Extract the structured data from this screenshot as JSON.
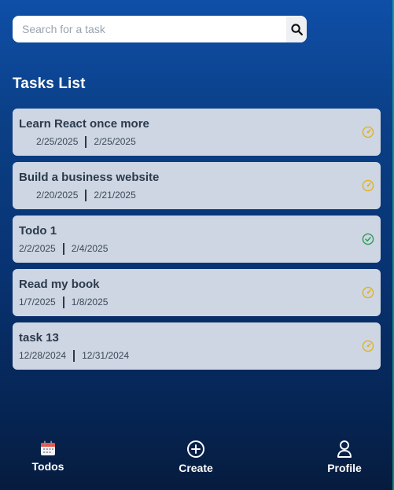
{
  "search": {
    "placeholder": "Search for a task"
  },
  "list": {
    "title": "Tasks List"
  },
  "tasks": [
    {
      "title": "Learn React once more",
      "start": "2/25/2025",
      "end": "2/25/2025",
      "status": "in-progress"
    },
    {
      "title": "Build a business website",
      "start": "2/20/2025",
      "end": "2/21/2025",
      "status": "in-progress"
    },
    {
      "title": "Todo 1",
      "start": "2/2/2025",
      "end": "2/4/2025",
      "status": "done"
    },
    {
      "title": "Read my book",
      "start": "1/7/2025",
      "end": "1/8/2025",
      "status": "in-progress"
    },
    {
      "title": "task 13",
      "start": "12/28/2024",
      "end": "12/31/2024",
      "status": "in-progress"
    }
  ],
  "nav": {
    "todos": "Todos",
    "create": "Create",
    "profile": "Profile"
  },
  "colors": {
    "in_progress": "#e2b21f",
    "done": "#2e9b53",
    "card": "#cdd6e2"
  },
  "icons": {
    "search": "search-icon",
    "in_progress": "speedometer-icon",
    "done": "check-circle-icon",
    "todos": "calendar-icon",
    "create": "plus-circle-icon",
    "profile": "user-icon"
  }
}
